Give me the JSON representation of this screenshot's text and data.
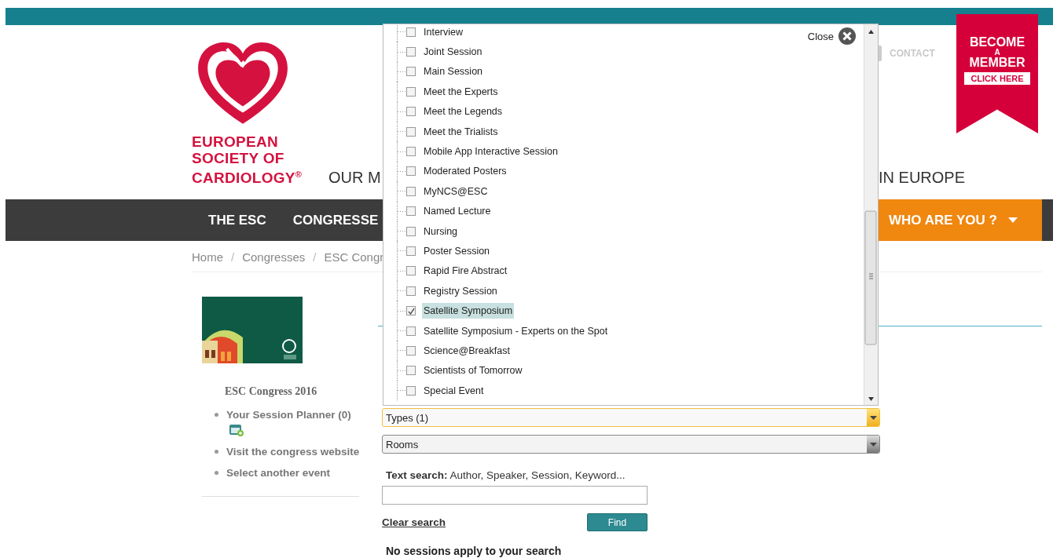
{
  "logo": {
    "lines": [
      "EUROPEAN",
      "SOCIETY OF",
      "CARDIOLOGY$^{®}$"
    ]
  },
  "tagline": [
    "OUR M",
    "IN EUROPE"
  ],
  "contact": "CONTACT",
  "member_ribbon": {
    "lines": [
      "BECOME",
      "A",
      "MEMBER"
    ],
    "button": "CLICK HERE"
  },
  "nav": {
    "items": [
      {
        "label": "THE ESC"
      },
      {
        "label": "CONGRESSE"
      }
    ],
    "menu": "WHO ARE YOU ?"
  },
  "breadcrumb": {
    "items": [
      "Home",
      "Congresses",
      "ESC Congr"
    ],
    "separators": [
      "/",
      "/"
    ]
  },
  "sidebar": {
    "title": "ESC Congress 2016",
    "links": [
      {
        "label": "Your Session Planner (0)",
        "kind": "planner"
      },
      {
        "label": "Visit the congress website",
        "kind": "link"
      },
      {
        "label": "Select another event",
        "kind": "link"
      }
    ]
  },
  "types_dropdown": {
    "close": "Close",
    "items": [
      {
        "label": "Interview",
        "checked": false,
        "selected": false
      },
      {
        "label": "Joint Session",
        "checked": false,
        "selected": false
      },
      {
        "label": "Main Session",
        "checked": false,
        "selected": false
      },
      {
        "label": "Meet the Experts",
        "checked": false,
        "selected": false
      },
      {
        "label": "Meet the Legends",
        "checked": false,
        "selected": false
      },
      {
        "label": "Meet the Trialists",
        "checked": false,
        "selected": false
      },
      {
        "label": "Mobile App Interactive Session",
        "checked": false,
        "selected": false
      },
      {
        "label": "Moderated Posters",
        "checked": false,
        "selected": false
      },
      {
        "label": "MyNCS@ESC",
        "checked": false,
        "selected": false
      },
      {
        "label": "Named Lecture",
        "checked": false,
        "selected": false
      },
      {
        "label": "Nursing",
        "checked": false,
        "selected": false
      },
      {
        "label": "Poster Session",
        "checked": false,
        "selected": false
      },
      {
        "label": "Rapid Fire Abstract",
        "checked": false,
        "selected": false
      },
      {
        "label": "Registry Session",
        "checked": false,
        "selected": false
      },
      {
        "label": "Satellite Symposium",
        "checked": true,
        "selected": true
      },
      {
        "label": "Satellite Symposium - Experts on the Spot",
        "checked": false,
        "selected": false
      },
      {
        "label": "Science@Breakfast",
        "checked": false,
        "selected": false
      },
      {
        "label": "Scientists of Tomorrow",
        "checked": false,
        "selected": false
      },
      {
        "label": "Special Event",
        "checked": false,
        "selected": false
      }
    ]
  },
  "filters": [
    {
      "label": "Types (1)",
      "focused": true
    },
    {
      "label": "Rooms",
      "focused": false
    }
  ],
  "text_search": {
    "label": "**Text search:** Author, Speaker, Session, Keyword..."
  },
  "clear_search": "Clear search",
  "find_button": "Find",
  "result": "No sessions apply to your search"
}
